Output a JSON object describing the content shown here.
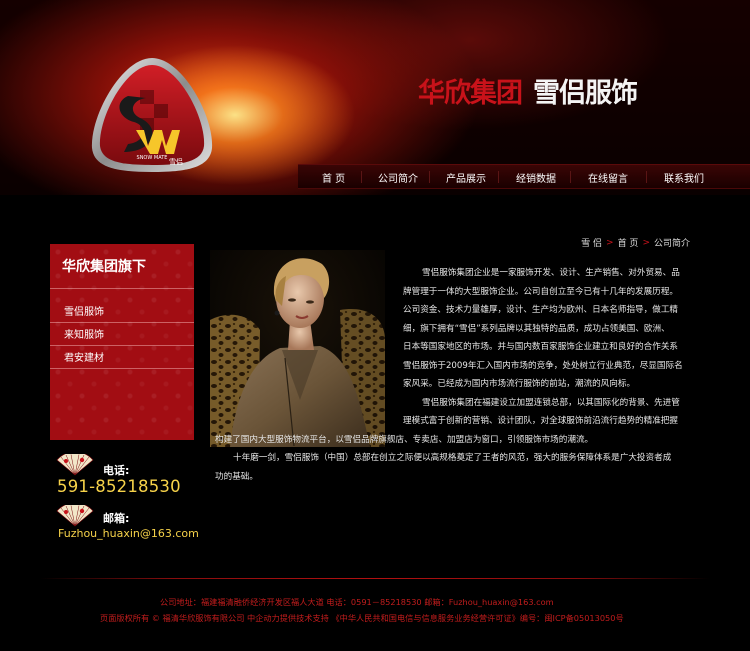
{
  "colors": {
    "accent_red": "#c8121a",
    "panel_red": "#a20d13",
    "highlight_gold": "#f6d24a",
    "background": "#000000"
  },
  "header": {
    "brand_group": "华欣集团",
    "brand_name": "雪侣服饰",
    "logo": {
      "monogram": "Sm",
      "text_en": "SNOW MATE",
      "text_cn": "雪侣"
    }
  },
  "nav": {
    "items": [
      {
        "label": "首 页"
      },
      {
        "label": "公司简介"
      },
      {
        "label": "产品展示"
      },
      {
        "label": "经销数据"
      },
      {
        "label": "在线留言"
      },
      {
        "label": "联系我们"
      }
    ]
  },
  "sidebar": {
    "title": "华欣集团旗下",
    "items": [
      {
        "label": "雪侣服饰"
      },
      {
        "label": "来知服饰"
      },
      {
        "label": "君安建材"
      }
    ],
    "contact": {
      "phone_label": "电话:",
      "phone": "591-85218530",
      "email_label": "邮箱:",
      "email": "Fuzhou_huaxin@163.com",
      "icon": "folding-fan-icon"
    }
  },
  "breadcrumb": {
    "items": [
      "雪 侣",
      "首 页",
      "公司简介"
    ]
  },
  "article": {
    "lines": [
      "雪侣服饰集团企业是一家服饰开发、设计、生产销售、对外贸易、品",
      "牌管理于一体的大型服饰企业。公司自创立至今已有十几年的发展历程。",
      "公司资金、技术力量雄厚，设计、生产均为欧州、日本名师指导，做工精",
      "细，旗下拥有“雪侣”系列品牌以其独特的品质，成功占领美国、欧洲、",
      "日本等国家地区的市场。并与国内数百家服饰企业建立和良好的合作关系",
      "雪侣服饰于2009年汇入国内市场的竞争，处处树立行业典范，尽显国际名",
      "家风采。已经成为国内市场流行服饰的前站，潮流的风向标。",
      "雪侣服饰集团在福建设立加盟连锁总部，以其国际化的背景、先进管",
      "理模式富于创新的营销、设计团队，对全球服饰前沿流行趋势的精准把握",
      "构建了国内大型服饰物流平台，以雪侣品牌旗舰店、专卖店、加盟店为窗口，引领服饰市场的潮流。",
      "十年磨一剑，雪侣服饰（中国）总部在创立之际便以高规格奠定了王者的风范，强大的服务保障体系是广大投资者成",
      "功的基础。"
    ]
  },
  "footer": {
    "line1": "公司地址：福建福清融侨经济开发区福人大道  电话：0591－85218530 邮箱：Fuzhou_huaxin@163.com",
    "line2": "页面版权所有 © 福清华欣服饰有限公司    中企动力提供技术支持    《中华人民共和国电信与信息服务业务经营许可证》编号：闽ICP备05013050号"
  }
}
